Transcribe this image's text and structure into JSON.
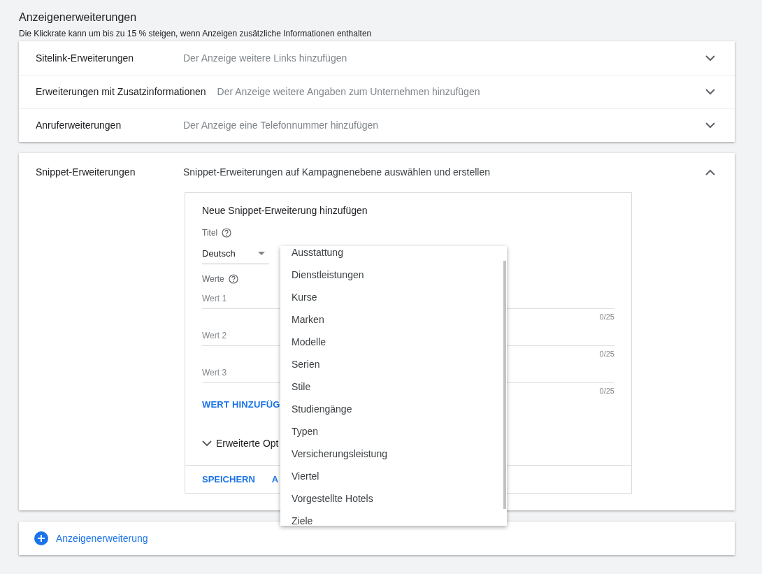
{
  "header": {
    "title": "Anzeigenerweiterungen",
    "subtitle": "Die Klickrate kann um bis zu 15 % steigen, wenn Anzeigen zusätzliche Informationen enthalten"
  },
  "extensions": [
    {
      "name": "Sitelink-Erweiterungen",
      "description": "Der Anzeige weitere Links hinzufügen",
      "expanded": false
    },
    {
      "name": "Erweiterungen mit Zusatzinformationen",
      "description": "Der Anzeige weitere Angaben zum Unternehmen hinzufügen",
      "expanded": false
    },
    {
      "name": "Anruferweiterungen",
      "description": "Der Anzeige eine Telefonnummer hinzufügen",
      "expanded": false
    }
  ],
  "snippet": {
    "name": "Snippet-Erweiterungen",
    "description": "Snippet-Erweiterungen auf Kampagnenebene auswählen und erstellen",
    "expanded": true,
    "form": {
      "title": "Neue Snippet-Erweiterung hinzufügen",
      "title_label": "Titel",
      "language": "Deutsch",
      "values_label": "Werte",
      "fields": [
        {
          "placeholder": "Wert 1",
          "counter": "0/25"
        },
        {
          "placeholder": "Wert 2",
          "counter": "0/25"
        },
        {
          "placeholder": "Wert 3",
          "counter": "0/25"
        }
      ],
      "add_value": "WERT HINZUFÜG",
      "advanced": "Erweiterte Opt",
      "advanced_expanded": false,
      "save": "SPEICHERN",
      "cancel": "A"
    },
    "dropdown": [
      "Ausstattung",
      "Dienstleistungen",
      "Kurse",
      "Marken",
      "Modelle",
      "Serien",
      "Stile",
      "Studiengänge",
      "Typen",
      "Versicherungsleistung",
      "Viertel",
      "Vorgestellte Hotels",
      "Ziele"
    ]
  },
  "add_extension": "Anzeigenerweiterung"
}
